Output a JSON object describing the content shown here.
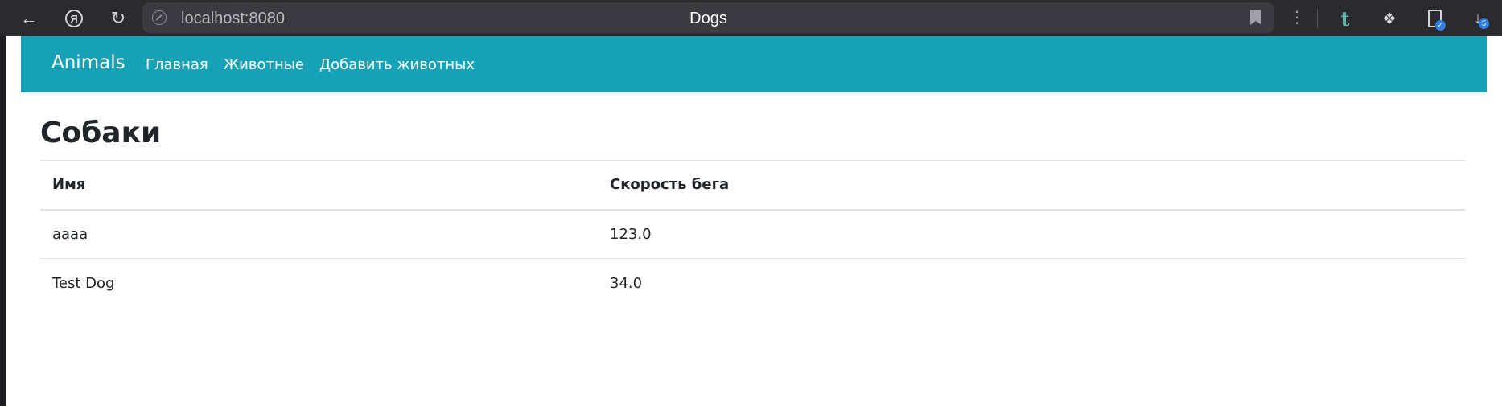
{
  "browser": {
    "url": "localhost:8080",
    "tab_title": "Dogs",
    "yandex_glyph": "Я",
    "extension_t": "t",
    "downloads_count": "5",
    "icons": [
      "back-arrow-icon",
      "yandex-icon",
      "reload-icon",
      "site-info-icon",
      "bookmark-icon",
      "menu-dots-icon",
      "t-extension-icon",
      "puzzle-extension-icon",
      "document-check-icon",
      "download-icon"
    ]
  },
  "navbar": {
    "brand": "Animals",
    "links": [
      "Главная",
      "Животные",
      "Добавить животных"
    ],
    "background_color": "#17a2b8"
  },
  "page": {
    "title": "Собаки"
  },
  "table": {
    "columns": [
      "Имя",
      "Скорость бега"
    ],
    "rows": [
      [
        "аааа",
        "123.0"
      ],
      [
        "Test Dog",
        "34.0"
      ]
    ]
  }
}
